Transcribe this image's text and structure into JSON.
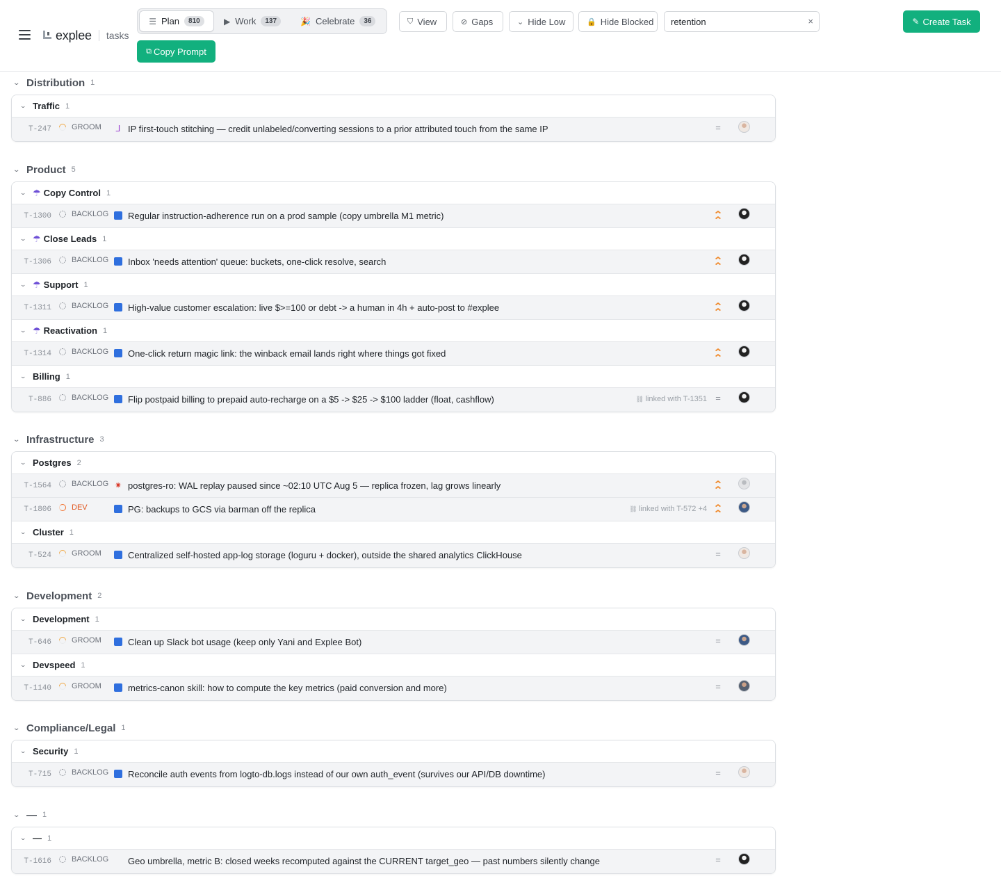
{
  "header": {
    "logo_text": "explee",
    "logo_sub": "tasks",
    "tabs": [
      {
        "label": "Plan",
        "count": "810",
        "icon": "list-icon",
        "glyph": "☰"
      },
      {
        "label": "Work",
        "count": "137",
        "icon": "play-icon",
        "glyph": "▶"
      },
      {
        "label": "Celebrate",
        "count": "36",
        "icon": "party-icon",
        "glyph": "🎉"
      }
    ],
    "copy_prompt_label": "Copy Prompt",
    "copy_prompt_glyph": "⧉",
    "filters": [
      {
        "label": "View",
        "icon": "filter-icon",
        "glyph": "⛉"
      },
      {
        "label": "Gaps",
        "icon": "user-off-icon",
        "glyph": "⊘"
      },
      {
        "label": "Hide Low",
        "icon": "chevron-down-icon",
        "glyph": "⌄"
      },
      {
        "label": "Hide Blocked",
        "icon": "lock-icon",
        "glyph": "🔒"
      }
    ],
    "search_value": "retention",
    "search_clear": "×",
    "create_task_label": "Create Task",
    "create_task_glyph": "✎"
  },
  "groups": [
    {
      "title": "Distribution",
      "count": "1",
      "subgroups": [
        {
          "title": "Traffic",
          "count": "1",
          "umbrella": false,
          "rows": [
            {
              "id": "T-247",
              "status": "GROOM",
              "type": "boot",
              "title": "IP first-touch stitching — credit unlabeled/converting sessions to a prior attributed touch from the same IP",
              "linked": "",
              "priority": "medium",
              "avatar": "light"
            }
          ]
        }
      ]
    },
    {
      "title": "Product",
      "count": "5",
      "subgroups": [
        {
          "title": "Copy Control",
          "count": "1",
          "umbrella": true,
          "rows": [
            {
              "id": "T-1300",
              "status": "BACKLOG",
              "type": "task",
              "title": "Regular instruction-adherence run on a prod sample (copy umbrella M1 metric)",
              "linked": "",
              "priority": "high",
              "avatar": "dark"
            }
          ]
        },
        {
          "title": "Close Leads",
          "count": "1",
          "umbrella": true,
          "rows": [
            {
              "id": "T-1306",
              "status": "BACKLOG",
              "type": "task",
              "title": "Inbox 'needs attention' queue: buckets, one-click resolve, search",
              "linked": "",
              "priority": "high",
              "avatar": "dark"
            }
          ]
        },
        {
          "title": "Support",
          "count": "1",
          "umbrella": true,
          "rows": [
            {
              "id": "T-1311",
              "status": "BACKLOG",
              "type": "task",
              "title": "High-value customer escalation: live $>=100 or debt -> a human in 4h + auto-post to #explee",
              "linked": "",
              "priority": "high",
              "avatar": "dark"
            }
          ]
        },
        {
          "title": "Reactivation",
          "count": "1",
          "umbrella": true,
          "rows": [
            {
              "id": "T-1314",
              "status": "BACKLOG",
              "type": "task",
              "title": "One-click return magic link: the winback email lands right where things got fixed",
              "linked": "",
              "priority": "high",
              "avatar": "dark"
            }
          ]
        },
        {
          "title": "Billing",
          "count": "1",
          "umbrella": false,
          "rows": [
            {
              "id": "T-886",
              "status": "BACKLOG",
              "type": "task",
              "title": "Flip postpaid billing to prepaid auto-recharge on a $5 -> $25 -> $100 ladder (float, cashflow)",
              "linked": "linked with T-1351",
              "priority": "medium",
              "avatar": "dark"
            }
          ]
        }
      ]
    },
    {
      "title": "Infrastructure",
      "count": "3",
      "subgroups": [
        {
          "title": "Postgres",
          "count": "2",
          "umbrella": false,
          "rows": [
            {
              "id": "T-1564",
              "status": "BACKLOG",
              "type": "bug",
              "title": "postgres-ro: WAL replay paused since ~02:10 UTC Aug 5 — replica frozen, lag grows linearly",
              "linked": "",
              "priority": "high",
              "avatar": "grey"
            },
            {
              "id": "T-1806",
              "status": "DEV",
              "type": "task",
              "title": "PG: backups to GCS via barman off the replica",
              "linked": "linked with T-572 +4",
              "priority": "high",
              "avatar": "blue"
            }
          ]
        },
        {
          "title": "Cluster",
          "count": "1",
          "umbrella": false,
          "rows": [
            {
              "id": "T-524",
              "status": "GROOM",
              "type": "task",
              "title": "Centralized self-hosted app-log storage (loguru + docker), outside the shared analytics ClickHouse",
              "linked": "",
              "priority": "medium",
              "avatar": "light"
            }
          ]
        }
      ]
    },
    {
      "title": "Development",
      "count": "2",
      "subgroups": [
        {
          "title": "Development",
          "count": "1",
          "umbrella": false,
          "rows": [
            {
              "id": "T-646",
              "status": "GROOM",
              "type": "task",
              "title": "Clean up Slack bot usage (keep only Yani and Explee Bot)",
              "linked": "",
              "priority": "medium",
              "avatar": "blue"
            }
          ]
        },
        {
          "title": "Devspeed",
          "count": "1",
          "umbrella": false,
          "rows": [
            {
              "id": "T-1140",
              "status": "GROOM",
              "type": "task",
              "title": "metrics-canon skill: how to compute the key metrics (paid conversion and more)",
              "linked": "",
              "priority": "medium",
              "avatar": "photo"
            }
          ]
        }
      ]
    },
    {
      "title": "Compliance/Legal",
      "count": "1",
      "subgroups": [
        {
          "title": "Security",
          "count": "1",
          "umbrella": false,
          "rows": [
            {
              "id": "T-715",
              "status": "BACKLOG",
              "type": "task",
              "title": "Reconcile auth events from logto-db.logs instead of our own auth_event (survives our API/DB downtime)",
              "linked": "",
              "priority": "medium",
              "avatar": "light"
            }
          ]
        }
      ]
    },
    {
      "title": "—",
      "count": "1",
      "subgroups": [
        {
          "title": "—",
          "count": "1",
          "umbrella": false,
          "rows": [
            {
              "id": "T-1616",
              "status": "BACKLOG",
              "type": "none",
              "title": "Geo umbrella, metric B: closed weeks recomputed against the CURRENT target_geo — past numbers silently change",
              "linked": "",
              "priority": "medium",
              "avatar": "dark"
            }
          ]
        }
      ]
    }
  ]
}
